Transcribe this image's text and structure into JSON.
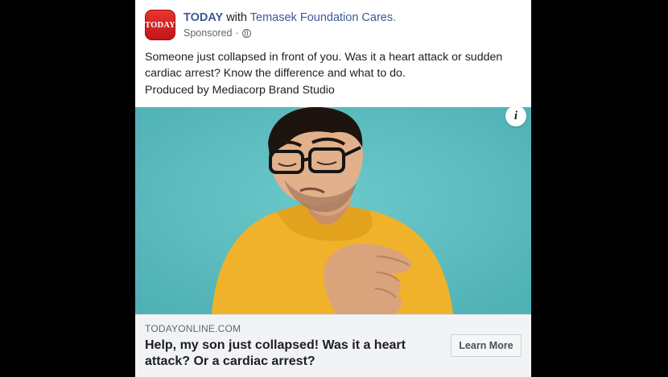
{
  "post": {
    "avatar_text": "TODAY",
    "page_name": "TODAY",
    "with_text": "with",
    "partner_name": "Temasek Foundation Cares.",
    "sponsored_label": "Sponsored",
    "separator": "·",
    "body_text": "Someone just collapsed in front of you. Was it a heart attack or sudden cardiac arrest? Know the difference and what to do.",
    "produced_by": "Produced by Mediacorp Brand Studio",
    "info_label": "i"
  },
  "link": {
    "domain": "TODAYONLINE.COM",
    "headline": "Help, my son just collapsed! Was it a heart attack? Or a cardiac arrest?",
    "cta_label": "Learn More"
  },
  "colors": {
    "brand_link": "#3b5998",
    "avatar_red": "#d7262c",
    "image_background": "#5cbcbf",
    "shirt": "#f0b22a"
  },
  "icons": [
    "globe-icon",
    "info-icon"
  ]
}
